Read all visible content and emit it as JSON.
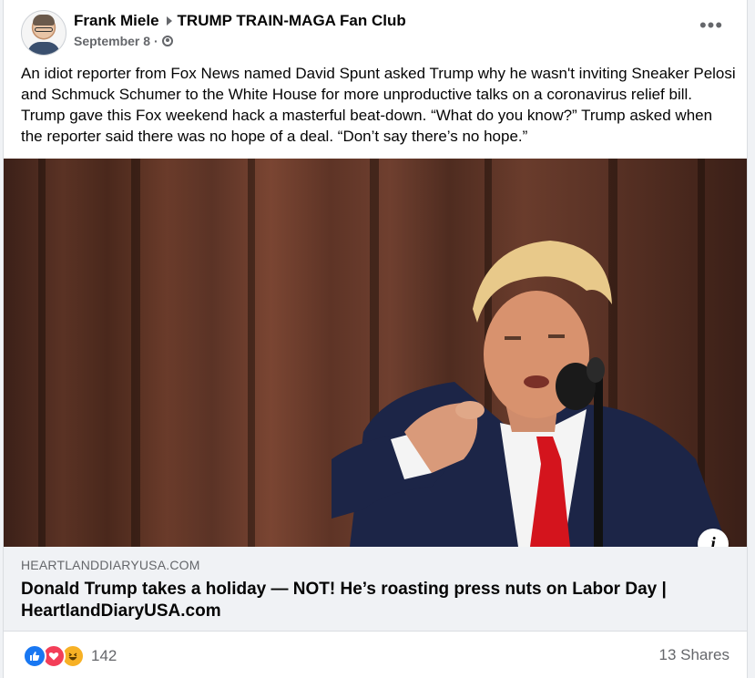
{
  "post": {
    "author": "Frank Miele",
    "group": "TRUMP TRAIN-MAGA Fan Club",
    "date": "September 8",
    "dot": "·",
    "more": "•••",
    "text": "An idiot reporter from Fox News named David Spunt asked Trump why he wasn't inviting Sneaker Pelosi and Schmuck Schumer to the White House for more unproductive talks on a coronavirus relief bill. Trump gave this Fox weekend hack a masterful beat-down. “What do you know?” Trump asked when the reporter said there was no hope of a deal. “Don’t say there’s no hope.”"
  },
  "link": {
    "domain": "HEARTLANDDIARYUSA.COM",
    "title": "Donald Trump takes a holiday — NOT! He’s roasting press nuts on Labor Day | HeartlandDiaryUSA.com",
    "info": "i"
  },
  "engagement": {
    "reaction_icons": [
      "like-icon",
      "love-icon",
      "haha-icon"
    ],
    "reaction_count": "142",
    "shares": "13 Shares"
  },
  "colors": {
    "like": "#1877f2",
    "love": "#f33e58",
    "haha": "#f7b125",
    "secondary_text": "#65676b"
  }
}
